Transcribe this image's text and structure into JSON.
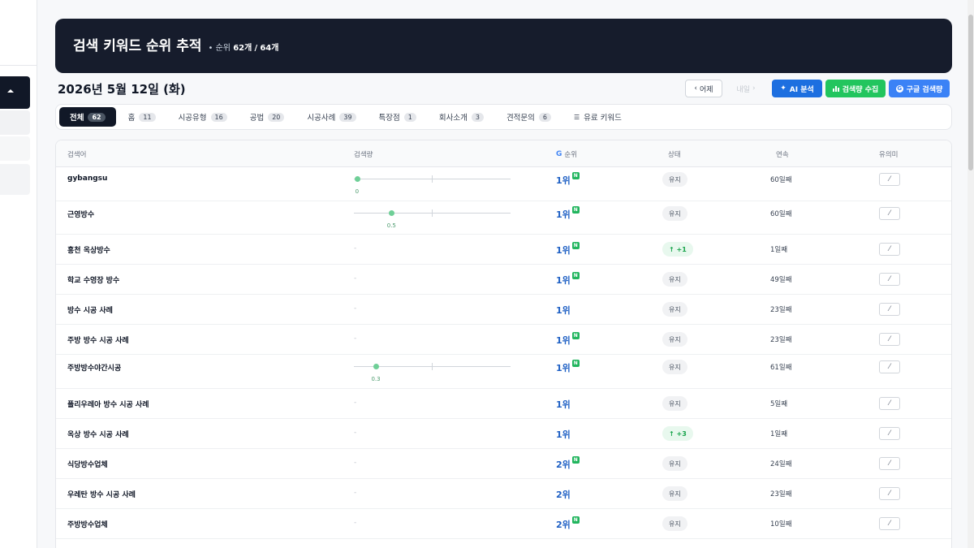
{
  "header": {
    "title": "검색 키워드 순위 추적",
    "sub_prefix": "• 순위",
    "ranked_count": "62개",
    "sep": "/",
    "total_count": "64개"
  },
  "date": "2026년 5월 12일 (화)",
  "nav": {
    "prev": "어제",
    "next": "내일"
  },
  "actions": {
    "ai": "AI 분석",
    "collect_volume": "검색량 수집",
    "google_volume": "구글 검색량"
  },
  "tabs": [
    {
      "label": "전체",
      "count": "62",
      "active": true
    },
    {
      "label": "홈",
      "count": "11"
    },
    {
      "label": "시공유형",
      "count": "16"
    },
    {
      "label": "공법",
      "count": "20"
    },
    {
      "label": "시공사례",
      "count": "39"
    },
    {
      "label": "특장점",
      "count": "1"
    },
    {
      "label": "회사소개",
      "count": "3"
    },
    {
      "label": "견적문의",
      "count": "6"
    },
    {
      "label": "유료 키워드",
      "count": ""
    }
  ],
  "table": {
    "headers": {
      "keyword": "검색어",
      "volume": "검색량",
      "rank": "순위",
      "status": "상태",
      "streak": "연속",
      "significance": "유의미"
    },
    "rows": [
      {
        "keyword": "gybangsu",
        "volume": "0",
        "volume_level": 0.02,
        "rank": "1위",
        "new": true,
        "status": "유지",
        "status_type": "keep",
        "streak": "60일째"
      },
      {
        "keyword": "근영방수",
        "volume": "0.5",
        "volume_level": 0.24,
        "rank": "1위",
        "new": true,
        "status": "유지",
        "status_type": "keep",
        "streak": "60일째"
      },
      {
        "keyword": "홍천 옥상방수",
        "volume": "-",
        "rank": "1위",
        "new": true,
        "status": "↑ +1",
        "status_type": "up",
        "streak": "1일째"
      },
      {
        "keyword": "학교 수영장 방수",
        "volume": "-",
        "rank": "1위",
        "new": true,
        "status": "유지",
        "status_type": "keep",
        "streak": "49일째"
      },
      {
        "keyword": "방수 시공 사례",
        "volume": "-",
        "rank": "1위",
        "new": false,
        "status": "유지",
        "status_type": "keep",
        "streak": "23일째"
      },
      {
        "keyword": "주방 방수 시공 사례",
        "volume": "-",
        "rank": "1위",
        "new": true,
        "status": "유지",
        "status_type": "keep",
        "streak": "23일째"
      },
      {
        "keyword": "주방방수야간시공",
        "volume": "0.3",
        "volume_level": 0.14,
        "rank": "1위",
        "new": true,
        "status": "유지",
        "status_type": "keep",
        "streak": "61일째"
      },
      {
        "keyword": "폴리우레아 방수 시공 사례",
        "volume": "-",
        "rank": "1위",
        "new": false,
        "status": "유지",
        "status_type": "keep",
        "streak": "5일째"
      },
      {
        "keyword": "옥상 방수 시공 사례",
        "volume": "-",
        "rank": "1위",
        "new": false,
        "status": "↑ +3",
        "status_type": "up",
        "streak": "1일째"
      },
      {
        "keyword": "식당방수업체",
        "volume": "-",
        "rank": "2위",
        "new": true,
        "status": "유지",
        "status_type": "keep",
        "streak": "24일째"
      },
      {
        "keyword": "우레탄 방수 시공 사례",
        "volume": "-",
        "rank": "2위",
        "new": false,
        "status": "유지",
        "status_type": "keep",
        "streak": "23일째"
      },
      {
        "keyword": "주방방수업체",
        "volume": "-",
        "rank": "2위",
        "new": true,
        "status": "유지",
        "status_type": "keep",
        "streak": "10일째"
      }
    ]
  },
  "icons": {
    "rank_header": "G",
    "new_badge": "N"
  }
}
